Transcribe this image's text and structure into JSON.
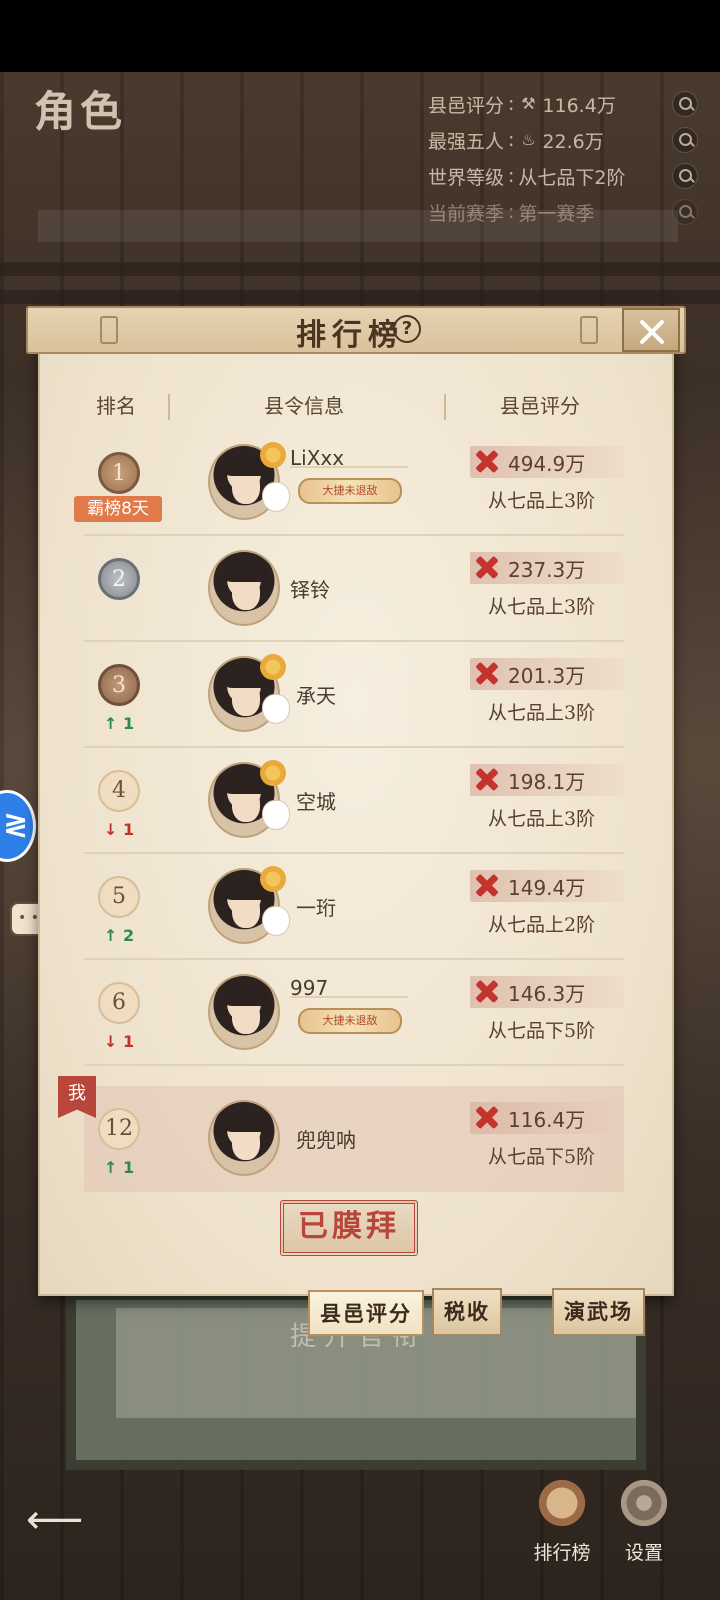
{
  "screen": {
    "title": "角色",
    "stats": [
      {
        "label": "县邑评分",
        "icon": "hammer-axe-icon",
        "value": "116.4万"
      },
      {
        "label": "最强五人",
        "icon": "pot-icon",
        "value": "22.6万"
      },
      {
        "label": "世界等级",
        "icon": "",
        "value": "从七品下2阶"
      },
      {
        "label": "当前赛季",
        "icon": "",
        "value": "第一赛季"
      }
    ],
    "separator": ":"
  },
  "modal": {
    "title": "排行榜",
    "help_icon": "?",
    "columns": [
      "排名",
      "县令信息",
      "县邑评分"
    ],
    "rows": [
      {
        "rank": "1",
        "badge": "gold",
        "streak": "霸榜8天",
        "trend": "",
        "trend_dir": "",
        "name": "LiXxx",
        "plaque": "大捷未退敌",
        "score": "494.9万",
        "level": "从七品上3阶"
      },
      {
        "rank": "2",
        "badge": "silver",
        "streak": "",
        "trend": "",
        "trend_dir": "",
        "name": "铎铃",
        "plaque": "",
        "score": "237.3万",
        "level": "从七品上3阶"
      },
      {
        "rank": "3",
        "badge": "bronze",
        "streak": "",
        "trend": "1",
        "trend_dir": "up",
        "name": "承天",
        "plaque": "",
        "score": "201.3万",
        "level": "从七品上3阶"
      },
      {
        "rank": "4",
        "badge": "plain",
        "streak": "",
        "trend": "1",
        "trend_dir": "down",
        "name": "空城",
        "plaque": "",
        "score": "198.1万",
        "level": "从七品上3阶"
      },
      {
        "rank": "5",
        "badge": "plain",
        "streak": "",
        "trend": "2",
        "trend_dir": "up",
        "name": "一珩",
        "plaque": "",
        "score": "149.4万",
        "level": "从七品上2阶"
      },
      {
        "rank": "6",
        "badge": "plain",
        "streak": "",
        "trend": "1",
        "trend_dir": "down",
        "name": "997",
        "plaque": "大捷未退敌",
        "score": "146.3万",
        "level": "从七品下5阶"
      },
      {
        "rank": "12",
        "badge": "plain",
        "streak": "",
        "trend": "1",
        "trend_dir": "up",
        "name": "兜兜呐",
        "plaque": "",
        "score": "116.4万",
        "level": "从七品下5阶",
        "me_flag": "我"
      }
    ],
    "worship_button": "已膜拜",
    "tabs": [
      "县邑评分",
      "税收",
      "演武场"
    ],
    "active_tab": 0
  },
  "background": {
    "notice_text": "提升官衔"
  },
  "bottom_nav": [
    {
      "label": "排行榜",
      "icon": "leaderboard-icon"
    },
    {
      "label": "设置",
      "icon": "gear-icon"
    }
  ],
  "colors": {
    "accent_red": "#c5332d",
    "trend_up": "#2e8a4b",
    "trend_down": "#c0322a",
    "streak_orange": "#e07a4a"
  }
}
